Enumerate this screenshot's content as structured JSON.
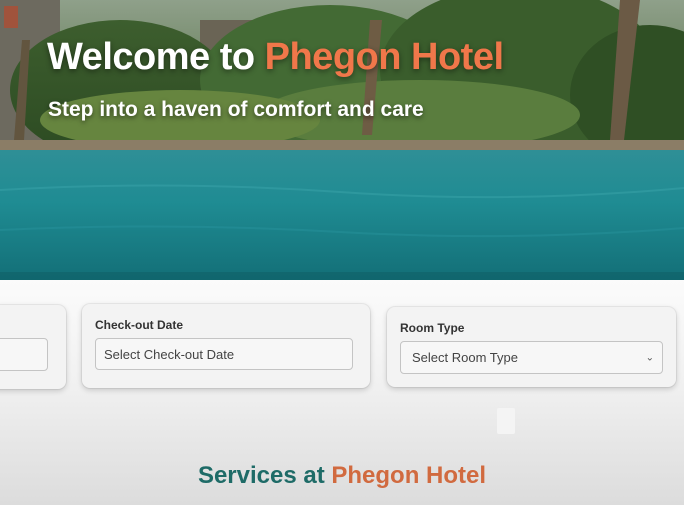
{
  "hero": {
    "title_prefix": "Welcome to ",
    "title_brand": "Phegon Hotel",
    "subtitle": "Step into a haven of comfort and care"
  },
  "booking": {
    "checkin": {
      "placeholder": ""
    },
    "checkout": {
      "label": "Check-out Date",
      "placeholder": "Select Check-out Date"
    },
    "room_type": {
      "label": "Room Type",
      "selected": "Select Room Type"
    }
  },
  "services": {
    "title_prefix": "Services at ",
    "title_brand": "Phegon Hotel"
  },
  "colors": {
    "brand_accent": "#f0774a",
    "services_teal": "#1e6b67",
    "services_orange": "#d16a3f"
  },
  "icons": [
    "chevron-down-icon"
  ]
}
